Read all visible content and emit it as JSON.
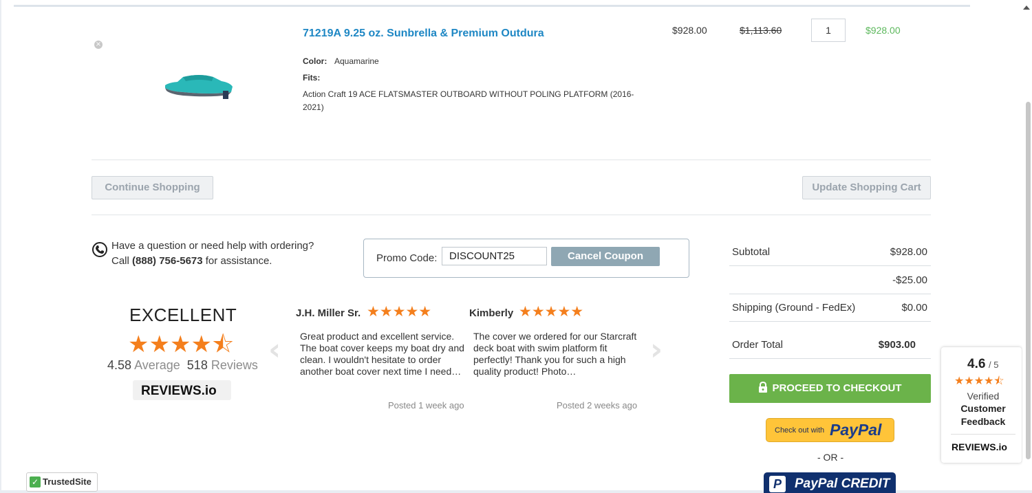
{
  "product": {
    "remove_icon": "×",
    "image_name": "boat-cover-image",
    "title": "71219A 9.25 oz. Sunbrella & Premium Outdura",
    "color_label": "Color:",
    "color_value": "Aquamarine",
    "fits_label": "Fits:",
    "fits_value": "Action Craft 19 ACE FLATSMASTER OUTBOARD WITHOUT POLING PLATFORM (2016-2021)",
    "unit_price": "$928.00",
    "old_price": "$1,113.60",
    "quantity": "1",
    "line_total": "$928.00",
    "cover_color": "#2ab8b8"
  },
  "cart_actions": {
    "continue_label": "Continue Shopping",
    "update_label": "Update Shopping Cart"
  },
  "help": {
    "line1": "Have a question or need help with ordering?",
    "call_prefix": "Call",
    "phone": "(888) 756-5673",
    "call_suffix": "for assistance."
  },
  "promo": {
    "label": "Promo Code:",
    "value": "DISCOUNT25",
    "cancel_label": "Cancel Coupon"
  },
  "totals": {
    "subtotal_label": "Subtotal",
    "subtotal_value": "$928.00",
    "discount_value": "-$25.00",
    "shipping_label": "Shipping (Ground - FedEx)",
    "shipping_value": "$0.00",
    "order_total_label": "Order Total",
    "order_total_value": "$903.00"
  },
  "checkout": {
    "proceed_label": "PROCEED TO CHECKOUT",
    "paypal_small": "Check out with",
    "paypal_word": "PayPal",
    "or_label": "- OR -",
    "paypal_credit_logo": "P",
    "paypal_credit_label": "PayPal CREDIT"
  },
  "reviews_summary": {
    "rating_word": "EXCELLENT",
    "stars": 4.5,
    "star_glyphs": "★★★★⯪",
    "average": "4.58",
    "average_label": "Average",
    "count": "518",
    "count_label": "Reviews",
    "logo": "REVIEWS.io"
  },
  "reviews": [
    {
      "name": "J.H. Miller Sr.",
      "stars": 5,
      "star_glyphs": "★★★★★",
      "text": "Great product and excellent service. The boat cover keeps my boat dry and clean. I wouldn't hesitate to order another boat cover next time I need…",
      "posted": "Posted 1 week ago"
    },
    {
      "name": "Kimberly",
      "stars": 5,
      "star_glyphs": "★★★★★",
      "text": "The cover we ordered for our Starcraft deck boat with swim platform fit perfectly! Thank you for such a high quality product! Photo…",
      "posted": "Posted 2 weeks ago"
    }
  ],
  "carousel": {
    "prev_glyph": "‹",
    "next_glyph": "›"
  },
  "badge": {
    "score": "4.6",
    "score_suffix": "/ 5",
    "stars": 4.5,
    "star_glyphs": "★★★★⯪",
    "verified": "Verified",
    "customer": "Customer",
    "feedback": "Feedback",
    "logo": "REVIEWS.io"
  },
  "trusted_site": {
    "check": "✓",
    "label": "TrustedSite"
  },
  "colors": {
    "link_blue": "#1e87c4",
    "price_green": "#5cb85c",
    "checkout_green": "#6bb34a",
    "star_orange": "#f47f1d",
    "paypal_yellow": "#ffc439",
    "paypal_navy": "#10306e"
  }
}
